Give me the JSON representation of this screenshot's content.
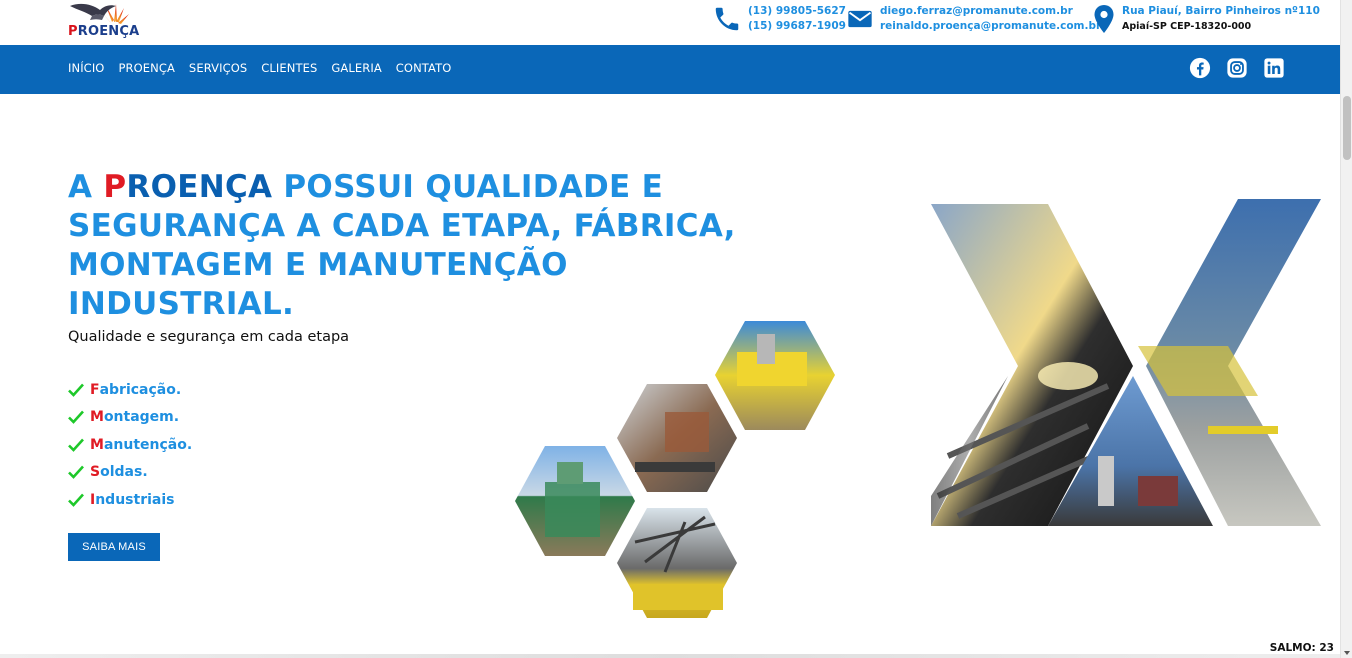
{
  "header": {
    "logo_text_first": "P",
    "logo_text_rest": "ROENÇA",
    "phones": [
      "(13) 99805-5627",
      "(15) 99687-1909"
    ],
    "emails": [
      "diego.ferraz@promanute.com.br",
      "reinaldo.proença@promanute.com.br"
    ],
    "address": [
      "Rua Piauí, Bairro Pinheiros nº110",
      "Apiaí-SP CEP-18320-000"
    ]
  },
  "nav": {
    "items": [
      "INÍCIO",
      "PROENÇA",
      "SERVIÇOS",
      "CLIENTES",
      "GALERIA",
      "CONTATO"
    ],
    "social": [
      "facebook-icon",
      "instagram-icon",
      "linkedin-icon"
    ]
  },
  "hero": {
    "title_article": "A ",
    "title_brand_first": "P",
    "title_brand_rest": "ROENÇA",
    "title_rest": " POSSUI QUALIDADE E SEGURANÇA A CADA ETAPA, FÁBRICA, MONTAGEM E MANUTENÇÃO INDUSTRIAL.",
    "subtitle": "Qualidade e segurança em cada etapa",
    "features": [
      {
        "first": "F",
        "rest": "abricação."
      },
      {
        "first": "M",
        "rest": "ontagem."
      },
      {
        "first": "M",
        "rest": "anutenção."
      },
      {
        "first": "S",
        "rest": "oldas."
      },
      {
        "first": "I",
        "rest": "ndustriais"
      }
    ],
    "cta_label": "SAIBA MAIS"
  },
  "footer_badge": "SALMO: 23",
  "colors": {
    "primary": "#0a67b8",
    "accent": "#1e8fe0",
    "brand_red": "#e01b24",
    "check_green": "#1ec82a"
  }
}
